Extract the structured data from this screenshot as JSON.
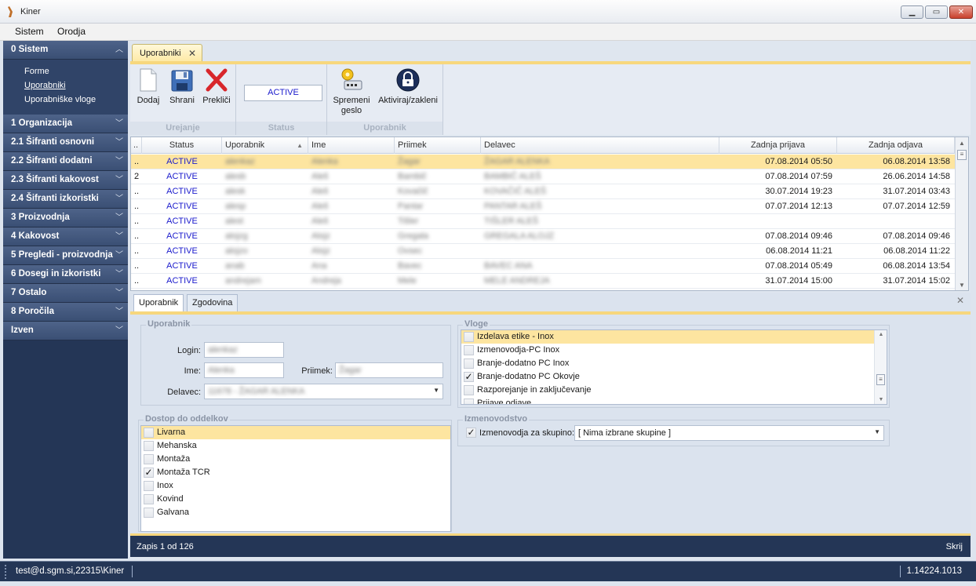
{
  "window": {
    "title": "Kiner"
  },
  "menu": [
    "Sistem",
    "Orodja"
  ],
  "nav": {
    "groups": [
      {
        "label": "0 Sistem",
        "expanded": true,
        "items": [
          "Forme",
          "Uporabniki",
          "Uporabniške vloge"
        ],
        "selected": "Uporabniki"
      },
      {
        "label": "1 Organizacija"
      },
      {
        "label": "2.1 Šifranti osnovni"
      },
      {
        "label": "2.2 Šifranti dodatni"
      },
      {
        "label": "2.3 Šifranti kakovost"
      },
      {
        "label": "2.4 Šifranti izkoristki"
      },
      {
        "label": "3 Proizvodnja"
      },
      {
        "label": "4 Kakovost"
      },
      {
        "label": "5 Pregledi - proizvodnja"
      },
      {
        "label": "6 Dosegi in izkoristki"
      },
      {
        "label": "7 Ostalo"
      },
      {
        "label": "8 Poročila"
      },
      {
        "label": "Izven"
      }
    ]
  },
  "doc_tab": {
    "label": "Uporabniki"
  },
  "ribbon": {
    "groups": {
      "urejanje": "Urejanje",
      "status": "Status",
      "uporabnik": "Uporabnik"
    },
    "buttons": {
      "add": "Dodaj",
      "save": "Shrani",
      "cancel": "Prekliči",
      "change_password_1": "Spremeni",
      "change_password_2": "geslo",
      "lock": "Aktiviraj/zakleni"
    },
    "status_value": "ACTIVE"
  },
  "grid": {
    "columns": [
      "..",
      "Status",
      "Uporabnik",
      "Ime",
      "Priimek",
      "Delavec",
      "Zadnja prijava",
      "Zadnja odjava"
    ],
    "rows": [
      {
        "ind": "..",
        "status": "ACTIVE",
        "user": "alenkaz",
        "ime": "Alenka",
        "priimek": "Žagar",
        "delavec": "ŽAGAR ALENKA",
        "login": "07.08.2014 05:50",
        "logout": "06.08.2014 13:58"
      },
      {
        "ind": "2",
        "status": "ACTIVE",
        "user": "alesb",
        "ime": "Aleš",
        "priimek": "Bambič",
        "delavec": "BAMBIČ ALEŠ",
        "login": "07.08.2014 07:59",
        "logout": "26.06.2014 14:58"
      },
      {
        "ind": "..",
        "status": "ACTIVE",
        "user": "alesk",
        "ime": "Aleš",
        "priimek": "Kovačič",
        "delavec": "KOVAČIČ ALEŠ",
        "login": "30.07.2014 19:23",
        "logout": "31.07.2014 03:43"
      },
      {
        "ind": "..",
        "status": "ACTIVE",
        "user": "alesp",
        "ime": "Aleš",
        "priimek": "Pantar",
        "delavec": "PANTAR ALEŠ",
        "login": "07.07.2014 12:13",
        "logout": "07.07.2014 12:59"
      },
      {
        "ind": "..",
        "status": "ACTIVE",
        "user": "alest",
        "ime": "Aleš",
        "priimek": "Tišler",
        "delavec": "TIŠLER ALEŠ",
        "login": "",
        "logout": ""
      },
      {
        "ind": "..",
        "status": "ACTIVE",
        "user": "alojzg",
        "ime": "Alojz",
        "priimek": "Gregala",
        "delavec": "GREGALA ALOJZ",
        "login": "07.08.2014 09:46",
        "logout": "07.08.2014 09:46"
      },
      {
        "ind": "..",
        "status": "ACTIVE",
        "user": "alojzo",
        "ime": "Alojz",
        "priimek": "Ovsec",
        "delavec": "",
        "login": "06.08.2014 11:21",
        "logout": "06.08.2014 11:22"
      },
      {
        "ind": "..",
        "status": "ACTIVE",
        "user": "anab",
        "ime": "Ana",
        "priimek": "Bavec",
        "delavec": "BAVEC ANA",
        "login": "07.08.2014 05:49",
        "logout": "06.08.2014 13:54"
      },
      {
        "ind": "..",
        "status": "ACTIVE",
        "user": "andrejam",
        "ime": "Andreja",
        "priimek": "Mele",
        "delavec": "MELE ANDREJA",
        "login": "31.07.2014 15:00",
        "logout": "31.07.2014 15:02"
      }
    ]
  },
  "detail": {
    "tabs": [
      "Uporabnik",
      "Zgodovina"
    ],
    "uporabnik": {
      "legend": "Uporabnik",
      "login_label": "Login:",
      "login_value": "alenkaz",
      "ime_label": "Ime:",
      "ime_value": "Alenka",
      "priimek_label": "Priimek:",
      "priimek_value": "Žagar",
      "delavec_label": "Delavec:",
      "delavec_value": "11678 - ŽAGAR ALENKA"
    },
    "vloge": {
      "legend": "Vloge",
      "items": [
        {
          "label": "Izdelava etike - Inox",
          "checked": false,
          "selected": true
        },
        {
          "label": "Izmenovodja-PC Inox",
          "checked": false
        },
        {
          "label": "Branje-dodatno PC Inox",
          "checked": false
        },
        {
          "label": "Branje-dodatno PC Okovje",
          "checked": true
        },
        {
          "label": "Razporejanje in zaključevanje",
          "checked": false
        },
        {
          "label": "Prijave odjave",
          "checked": false
        }
      ]
    },
    "dostop": {
      "legend": "Dostop do oddelkov",
      "items": [
        {
          "label": "Livarna",
          "checked": false,
          "selected": true
        },
        {
          "label": "Mehanska",
          "checked": false
        },
        {
          "label": "Montaža",
          "checked": false
        },
        {
          "label": "Montaža TCR",
          "checked": true
        },
        {
          "label": "Inox",
          "checked": false
        },
        {
          "label": "Kovind",
          "checked": false
        },
        {
          "label": "Galvana",
          "checked": false
        }
      ]
    },
    "izmenovodstvo": {
      "legend": "Izmenovodstvo",
      "checkbox_label": "Izmenovodja za skupino:",
      "checked": true,
      "combo_value": "[ Nima izbrane skupine ]"
    }
  },
  "footer": {
    "record": "Zapis 1 od 126",
    "hide": "Skrij"
  },
  "statusbar": {
    "user": "test@d.sgm.si,22315\\Kiner",
    "version": "1.14224.1013"
  }
}
